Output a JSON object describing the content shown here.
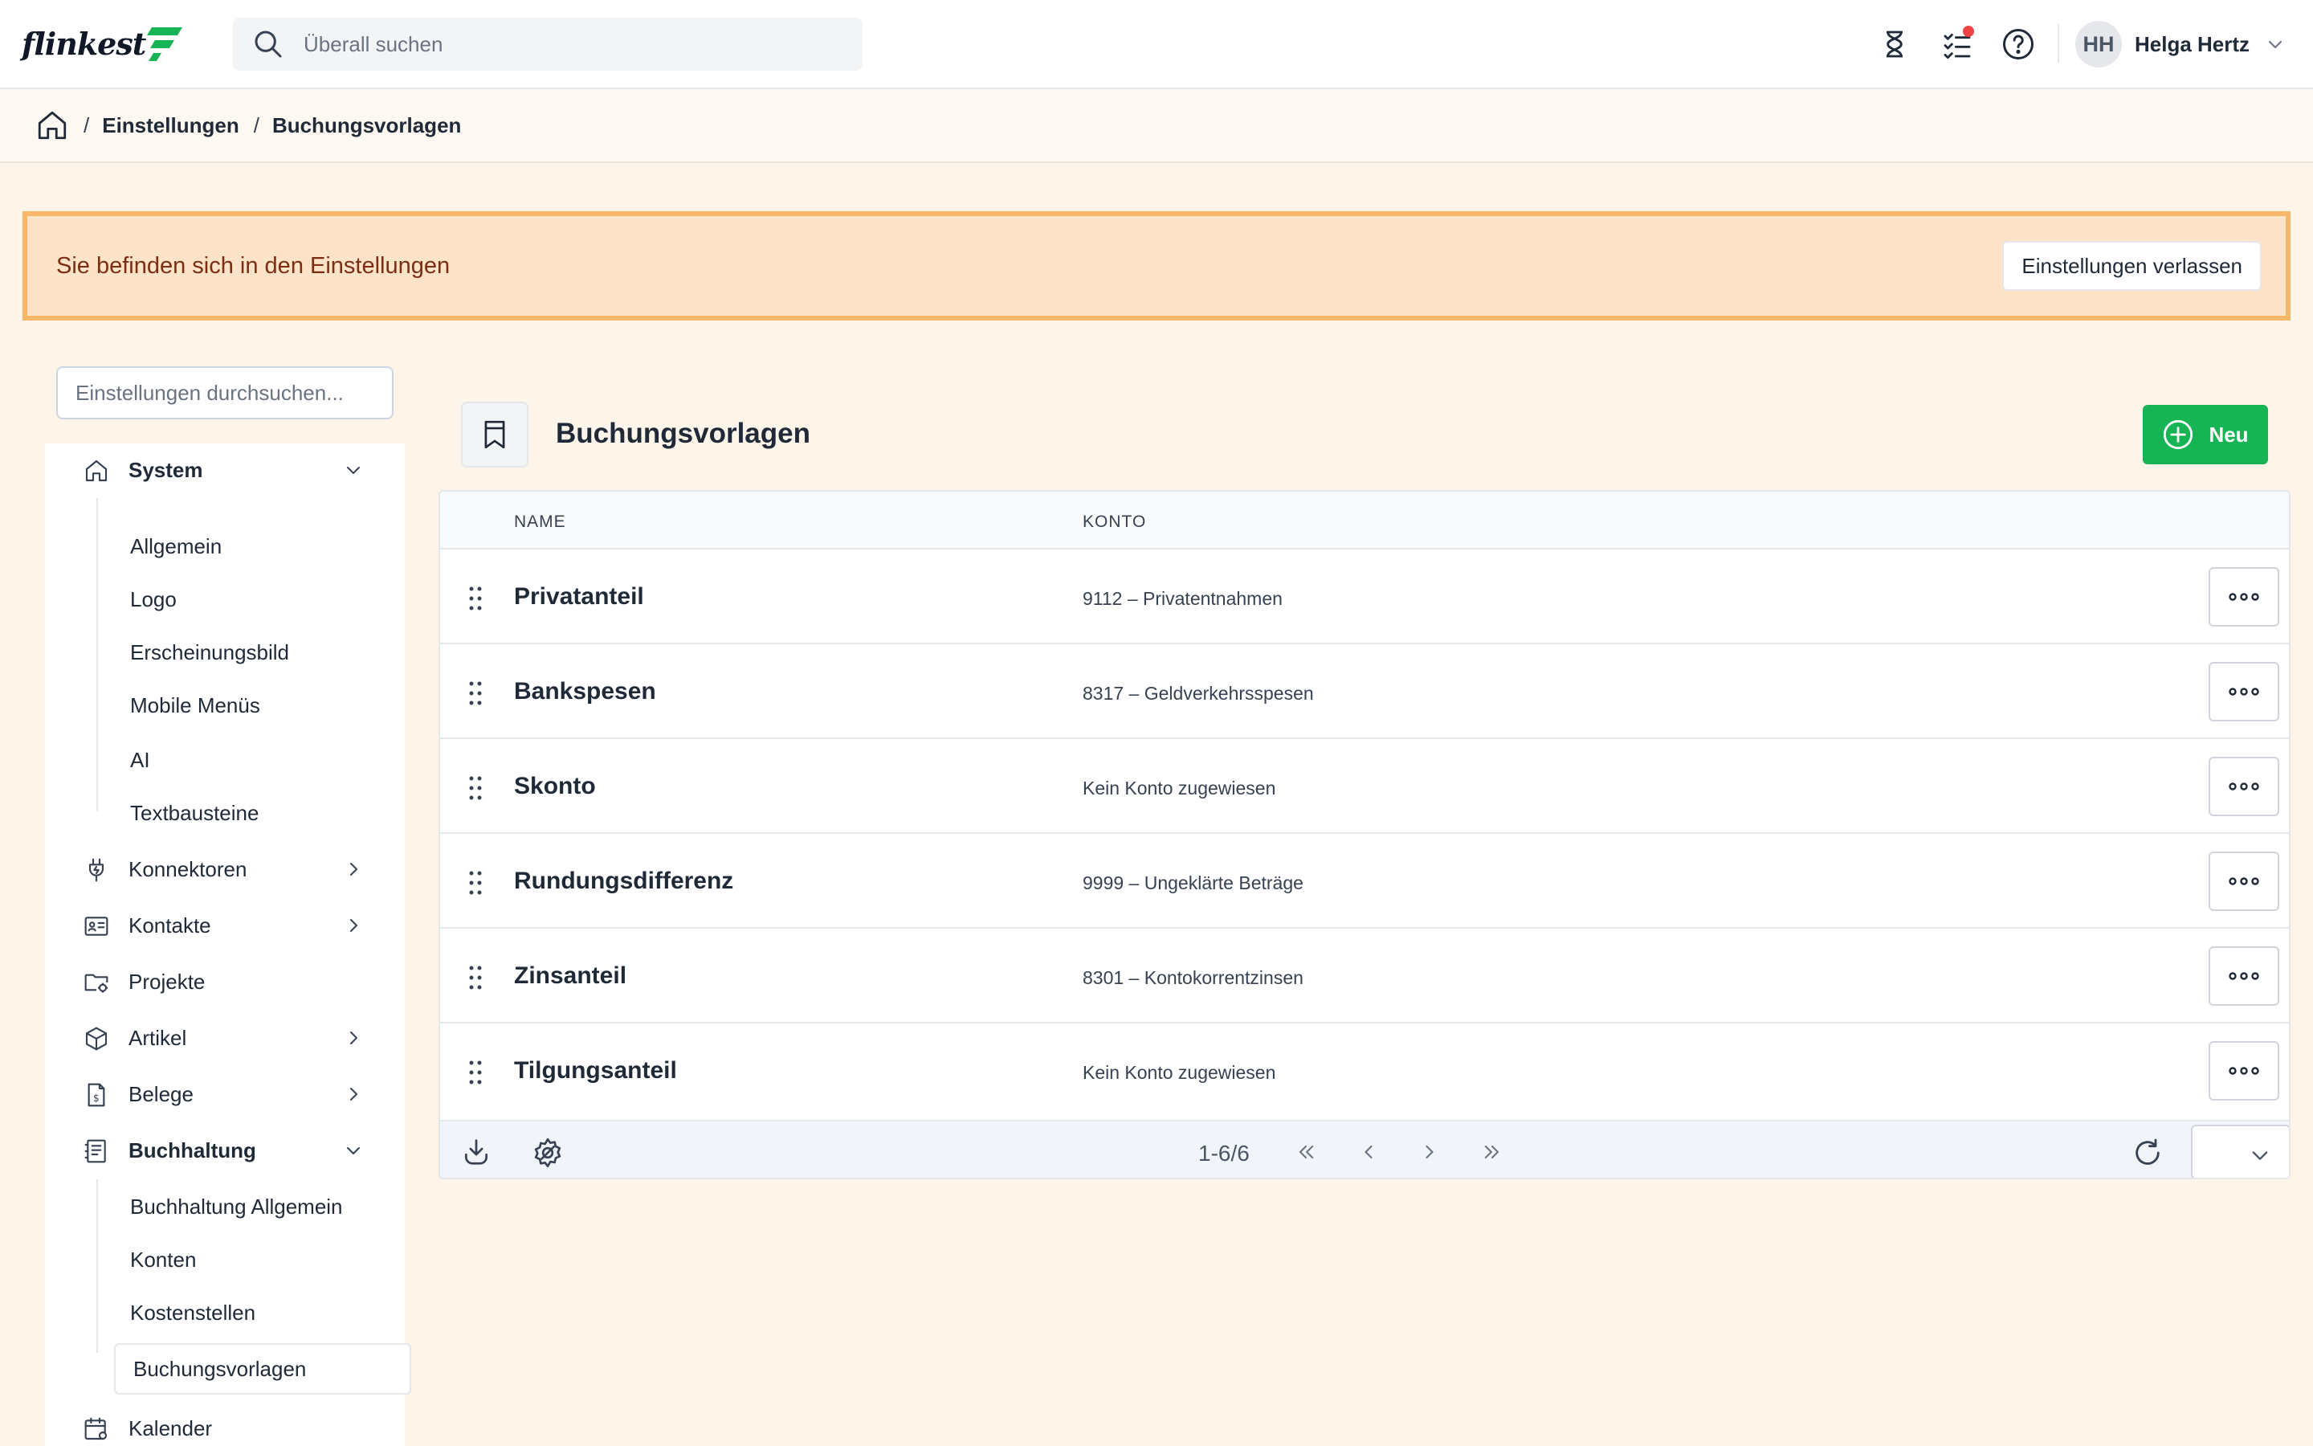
{
  "app": {
    "logo_text": "flinkest",
    "brand_color": "#16b454",
    "accent_warning": "#f9b769"
  },
  "header": {
    "search_placeholder": "Überall suchen",
    "icons": [
      "hourglass-icon",
      "task-list-icon",
      "help-icon"
    ],
    "user": {
      "initials": "HH",
      "name": "Helga Hertz"
    }
  },
  "breadcrumb": {
    "items": [
      "Einstellungen",
      "Buchungsvorlagen"
    ]
  },
  "banner": {
    "text": "Sie befinden sich in den Einstellungen",
    "button_label": "Einstellungen verlassen"
  },
  "sidebar": {
    "search_placeholder": "Einstellungen durchsuchen...",
    "sections": [
      {
        "label": "System",
        "icon": "home-icon",
        "expanded": true,
        "children": [
          "Allgemein",
          "Logo",
          "Erscheinungsbild",
          "Mobile Menüs",
          "AI",
          "Textbausteine"
        ]
      },
      {
        "label": "Konnektoren",
        "icon": "plug-icon",
        "expandable": true
      },
      {
        "label": "Kontakte",
        "icon": "contact-card-icon",
        "expandable": true
      },
      {
        "label": "Projekte",
        "icon": "folder-gear-icon"
      },
      {
        "label": "Artikel",
        "icon": "cube-icon",
        "expandable": true
      },
      {
        "label": "Belege",
        "icon": "receipt-icon",
        "expandable": true
      },
      {
        "label": "Buchhaltung",
        "icon": "ledger-icon",
        "expanded": true,
        "children": [
          "Buchhaltung Allgemein",
          "Konten",
          "Kostenstellen",
          "Buchungsvorlagen"
        ],
        "active_child": "Buchungsvorlagen"
      },
      {
        "label": "Kalender",
        "icon": "calendar-gear-icon"
      }
    ]
  },
  "main": {
    "title": "Buchungsvorlagen",
    "new_button_label": "Neu",
    "table": {
      "columns": [
        "NAME",
        "KONTO"
      ],
      "rows": [
        {
          "name": "Privatanteil",
          "konto": "9112 – Privatentnahmen"
        },
        {
          "name": "Bankspesen",
          "konto": "8317 – Geldverkehrsspesen"
        },
        {
          "name": "Skonto",
          "konto": "Kein Konto zugewiesen"
        },
        {
          "name": "Rundungsdifferenz",
          "konto": "9999 – Ungeklärte Beträge"
        },
        {
          "name": "Zinsanteil",
          "konto": "8301 – Kontokorrentzinsen"
        },
        {
          "name": "Tilgungsanteil",
          "konto": "Kein Konto zugewiesen"
        }
      ]
    },
    "pagination": {
      "range": "1-6/6"
    }
  }
}
